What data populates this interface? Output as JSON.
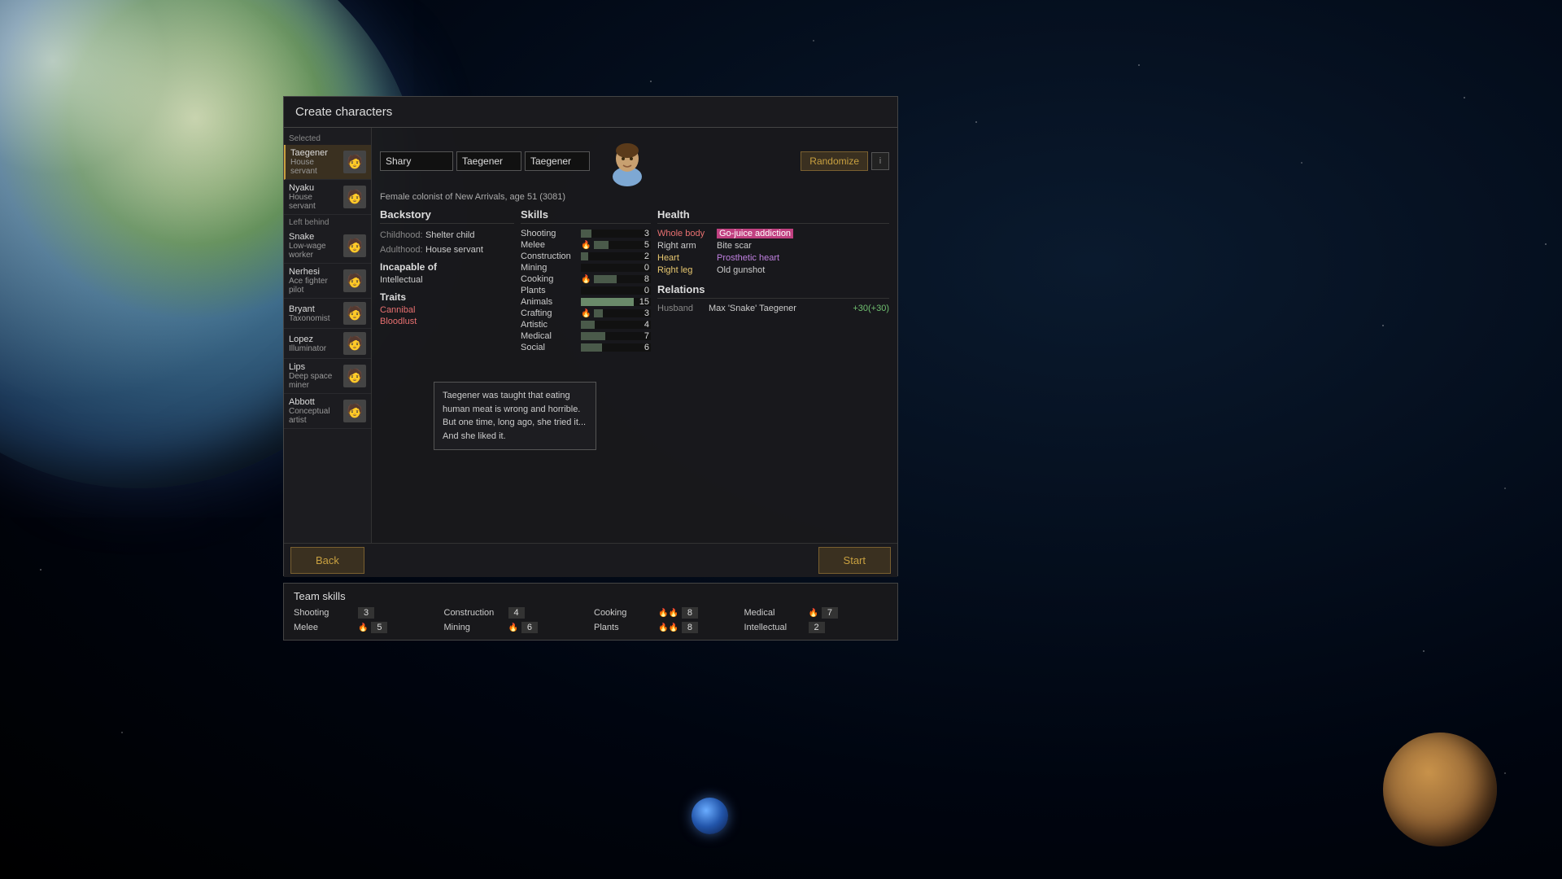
{
  "title": "Create characters",
  "selected_label": "Selected",
  "left_behind_label": "Left behind",
  "characters": {
    "selected": [
      {
        "name": "Taegener",
        "role": "House servant",
        "avatar": "👤",
        "selected": true
      },
      {
        "name": "Nyaku",
        "role": "House servant",
        "avatar": "👤"
      }
    ],
    "left_behind": [
      {
        "name": "Snake",
        "role": "Low-wage worker",
        "avatar": "👤"
      },
      {
        "name": "Nerhesi",
        "role": "Ace fighter pilot",
        "avatar": "👤"
      },
      {
        "name": "Bryant",
        "role": "Taxonomist",
        "avatar": "👤"
      },
      {
        "name": "Lopez",
        "role": "Illuminator",
        "avatar": "👤"
      },
      {
        "name": "Lips",
        "role": "Deep space miner",
        "avatar": "👤"
      },
      {
        "name": "Abbott",
        "role": "Conceptual artist",
        "avatar": "👤"
      }
    ]
  },
  "char_editor": {
    "first_name": "Shary",
    "last_name": "Taegener",
    "surname": "Taegener",
    "description": "Female colonist of New Arrivals, age 51 (3081)",
    "randomize_label": "Randomize",
    "info_label": "i",
    "backstory": {
      "title": "Backstory",
      "childhood_label": "Childhood:",
      "childhood_value": "Shelter child",
      "adulthood_label": "Adulthood:",
      "adulthood_value": "House servant"
    },
    "incapable": {
      "title": "Incapable of",
      "items": [
        "Intellectual"
      ]
    },
    "traits": {
      "title": "Traits",
      "items": [
        {
          "name": "Cannibal",
          "bad": true
        },
        {
          "name": "Bloodlust",
          "bad": false
        }
      ]
    },
    "skills": {
      "title": "Skills",
      "items": [
        {
          "name": "Shooting",
          "fire": false,
          "value": 3,
          "max": 20
        },
        {
          "name": "Melee",
          "fire": true,
          "value": 5,
          "max": 20
        },
        {
          "name": "Construction",
          "fire": false,
          "value": 2,
          "max": 20
        },
        {
          "name": "Mining",
          "fire": false,
          "value": 0,
          "max": 20
        },
        {
          "name": "Cooking",
          "fire": true,
          "value": 8,
          "max": 20
        },
        {
          "name": "Plants",
          "fire": false,
          "value": 0,
          "max": 20
        },
        {
          "name": "Animals",
          "fire": false,
          "value": 15,
          "max": 20
        },
        {
          "name": "Crafting",
          "fire": true,
          "value": 3,
          "max": 20
        },
        {
          "name": "Artistic",
          "fire": false,
          "value": 4,
          "max": 20
        },
        {
          "name": "Medical",
          "fire": false,
          "value": 7,
          "max": 20
        },
        {
          "name": "Social",
          "fire": false,
          "value": 6,
          "max": 20
        }
      ]
    },
    "health": {
      "title": "Health",
      "rows": [
        {
          "part": "Whole body",
          "condition": "Go-juice addiction",
          "part_bad": true,
          "cond_special": "pink"
        },
        {
          "part": "Right arm",
          "condition": "Bite scar",
          "part_bad": false,
          "cond_special": ""
        },
        {
          "part": "Heart",
          "condition": "Prosthetic heart",
          "part_bad": false,
          "cond_special": "purple"
        },
        {
          "part": "Right leg",
          "condition": "Old gunshot",
          "part_bad": false,
          "cond_special": ""
        }
      ]
    },
    "relations": {
      "title": "Relations",
      "rows": [
        {
          "type": "Husband",
          "name": "Max 'Snake' Taegener",
          "value": "+30(+30)"
        }
      ]
    }
  },
  "tooltip": {
    "text": "Taegener was taught that eating human meat is wrong and horrible. But one time, long ago, she tried it... And she liked it."
  },
  "team_skills": {
    "title": "Team skills",
    "items": [
      {
        "name": "Shooting",
        "fire": false,
        "value": 3
      },
      {
        "name": "Construction",
        "fire": false,
        "value": 4
      },
      {
        "name": "Cooking",
        "fire": true,
        "value": 8
      },
      {
        "name": "Medical",
        "fire": true,
        "value": 7
      },
      {
        "name": "Melee",
        "fire": true,
        "value": 5
      },
      {
        "name": "Mining",
        "fire": true,
        "value": 6
      },
      {
        "name": "Plants",
        "fire": true,
        "value": 8
      },
      {
        "name": "Intellectual",
        "fire": false,
        "value": 2
      }
    ]
  },
  "buttons": {
    "back": "Back",
    "start": "Start"
  }
}
